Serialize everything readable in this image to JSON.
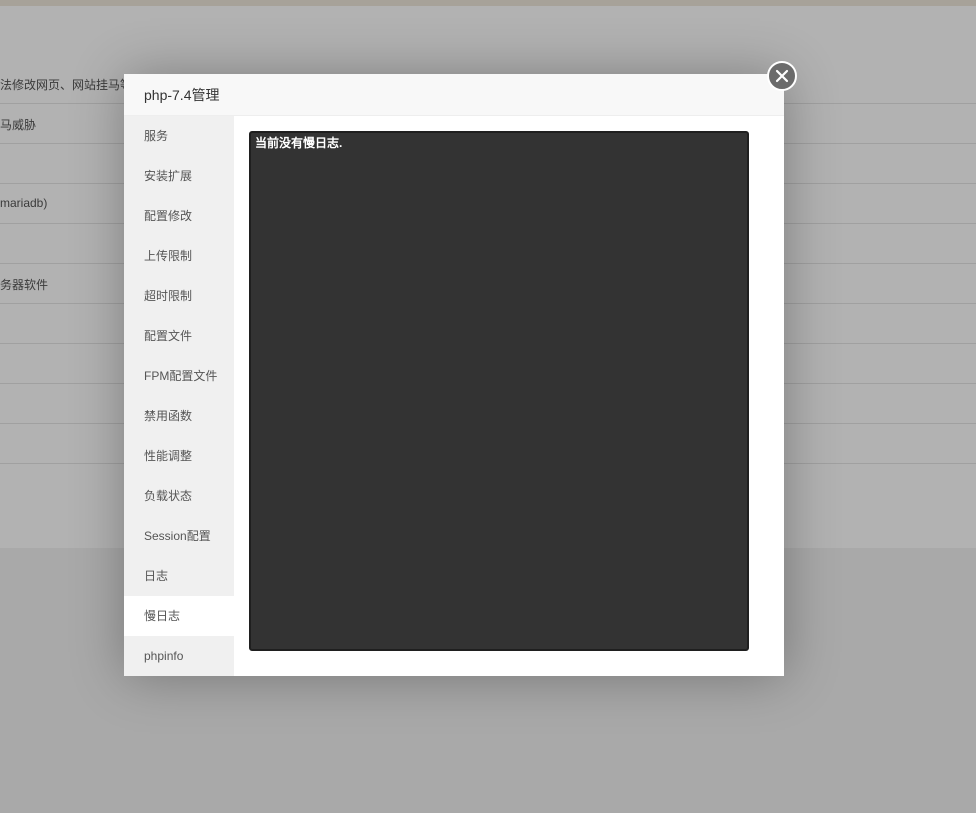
{
  "background": {
    "rows": [
      "法修改网页、网站挂马等",
      "马威胁",
      "",
      "mariadb)",
      "",
      "务器软件",
      "",
      "",
      "",
      ""
    ]
  },
  "dialog": {
    "title": "php-7.4管理",
    "close_icon": "close-icon",
    "menu": [
      {
        "label": "服务",
        "active": false
      },
      {
        "label": "安装扩展",
        "active": false
      },
      {
        "label": "配置修改",
        "active": false
      },
      {
        "label": "上传限制",
        "active": false
      },
      {
        "label": "超时限制",
        "active": false
      },
      {
        "label": "配置文件",
        "active": false
      },
      {
        "label": "FPM配置文件",
        "active": false
      },
      {
        "label": "禁用函数",
        "active": false
      },
      {
        "label": "性能调整",
        "active": false
      },
      {
        "label": "负载状态",
        "active": false
      },
      {
        "label": "Session配置",
        "active": false
      },
      {
        "label": "日志",
        "active": false
      },
      {
        "label": "慢日志",
        "active": true
      },
      {
        "label": "phpinfo",
        "active": false
      }
    ],
    "log_text": "当前没有慢日志."
  }
}
